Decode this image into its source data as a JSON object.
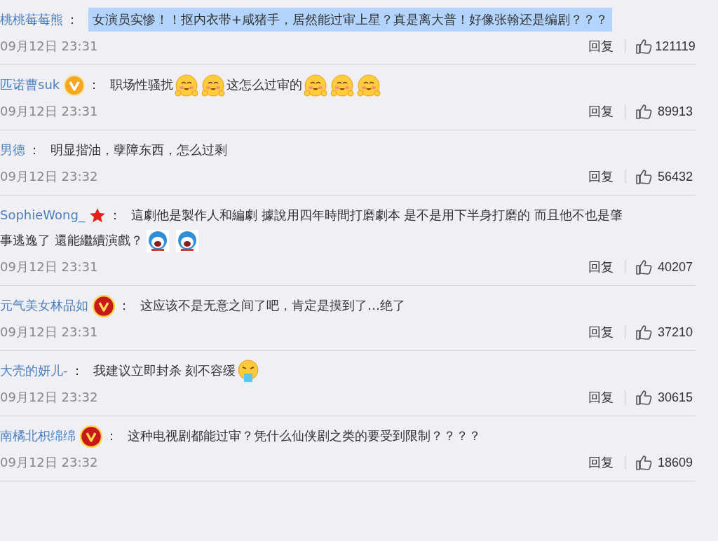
{
  "comments": [
    {
      "user": "桃桃莓莓熊",
      "separator": "：",
      "selected": true,
      "parts": [
        {
          "kind": "text",
          "text": "女演员实惨！！抠内衣带+咸猪手，居然能过审上星？真是离大普！好像张翰还是编剧？？？"
        }
      ],
      "time": "09月12日 23:31",
      "reply": "回复",
      "likes": "121119"
    },
    {
      "user": "匹诺曹suk",
      "badge": {
        "kind": "v-orange"
      },
      "separator": "：",
      "selected": false,
      "parts": [
        {
          "kind": "text",
          "text": "职场性骚扰"
        },
        {
          "kind": "blush"
        },
        {
          "kind": "blush"
        },
        {
          "kind": "text",
          "text": "这怎么过审的"
        },
        {
          "kind": "blush"
        },
        {
          "kind": "blush"
        },
        {
          "kind": "blush"
        }
      ],
      "time": "09月12日 23:31",
      "reply": "回复",
      "likes": "89913"
    },
    {
      "user": "男德",
      "separator": "：",
      "selected": false,
      "parts": [
        {
          "kind": "text",
          "text": "明显揩油，孽障东西，怎么过剩"
        }
      ],
      "time": "09月12日 23:32",
      "reply": "回复",
      "likes": "56432"
    },
    {
      "user": "SophieWong_",
      "badge": {
        "kind": "star"
      },
      "separator": "：",
      "selected": false,
      "parts": [
        {
          "kind": "text",
          "text": "這劇他是製作人和編劇 據說用四年時間打磨劇本 是不是用下半身打磨的 而且他不也是肇"
        },
        {
          "kind": "text",
          "text": "事逃逸了 還能繼續演戲？"
        },
        {
          "kind": "robot"
        },
        {
          "kind": "robot"
        }
      ],
      "time": "09月12日 23:31",
      "reply": "回复",
      "likes": "40207"
    },
    {
      "user": "元气美女林品如",
      "badge": {
        "kind": "v-red"
      },
      "separator": "：",
      "selected": false,
      "parts": [
        {
          "kind": "text",
          "text": "这应该不是无意之间了吧，肯定是摸到了…绝了"
        }
      ],
      "time": "09月12日 23:31",
      "reply": "回复",
      "likes": "37210"
    },
    {
      "user": "大壳的妍儿-",
      "separator": "：",
      "selected": false,
      "parts": [
        {
          "kind": "text",
          "text": "我建议立即封杀 刻不容缓"
        },
        {
          "kind": "vomit"
        }
      ],
      "time": "09月12日 23:32",
      "reply": "回复",
      "likes": "30615"
    },
    {
      "user": "南橘北枳绵绵",
      "badge": {
        "kind": "v-red"
      },
      "separator": "：",
      "selected": false,
      "parts": [
        {
          "kind": "text",
          "text": "这种电视剧都能过审？凭什么仙侠剧之类的要受到限制？？？？"
        }
      ],
      "time": "09月12日 23:32",
      "reply": "回复",
      "likes": "18609"
    }
  ]
}
